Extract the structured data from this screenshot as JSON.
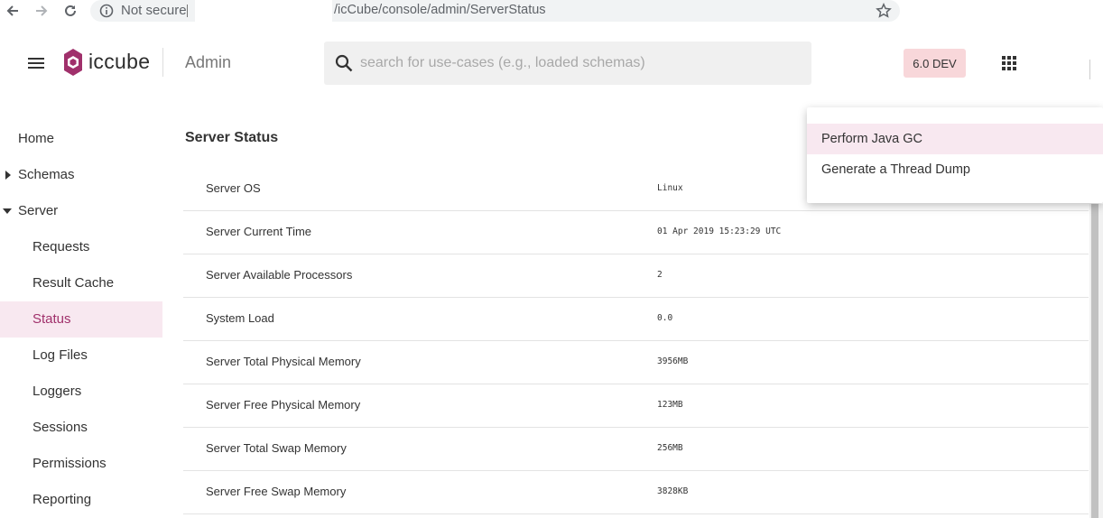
{
  "browser": {
    "security_label": "Not secure",
    "url": "/icCube/console/admin/ServerStatus"
  },
  "header": {
    "brand": "iccube",
    "title": "Admin",
    "search_placeholder": "search for use-cases (e.g., loaded schemas)",
    "version": "6.0 DEV"
  },
  "colors": {
    "brand": "#a0306b",
    "active_bg": "#f8e8f0",
    "version_bg": "#f8d7da"
  },
  "sidebar": {
    "items": [
      {
        "label": "Home"
      },
      {
        "label": "Schemas"
      },
      {
        "label": "Server"
      },
      {
        "label": "Requests"
      },
      {
        "label": "Result Cache"
      },
      {
        "label": "Status"
      },
      {
        "label": "Log Files"
      },
      {
        "label": "Loggers"
      },
      {
        "label": "Sessions"
      },
      {
        "label": "Permissions"
      },
      {
        "label": "Reporting"
      }
    ]
  },
  "main": {
    "title": "Server Status",
    "rows": [
      {
        "key": "Server OS",
        "value": "Linux"
      },
      {
        "key": "Server Current Time",
        "value": "01 Apr 2019 15:23:29 UTC"
      },
      {
        "key": "Server Available Processors",
        "value": "2"
      },
      {
        "key": "System Load",
        "value": "0.0"
      },
      {
        "key": "Server Total Physical Memory",
        "value": "3956MB"
      },
      {
        "key": "Server Free Physical Memory",
        "value": "123MB"
      },
      {
        "key": "Server Total Swap Memory",
        "value": "256MB"
      },
      {
        "key": "Server Free Swap Memory",
        "value": "3828KB"
      }
    ]
  },
  "menu": {
    "items": [
      {
        "label": "Perform Java GC"
      },
      {
        "label": "Generate a Thread Dump"
      }
    ]
  }
}
